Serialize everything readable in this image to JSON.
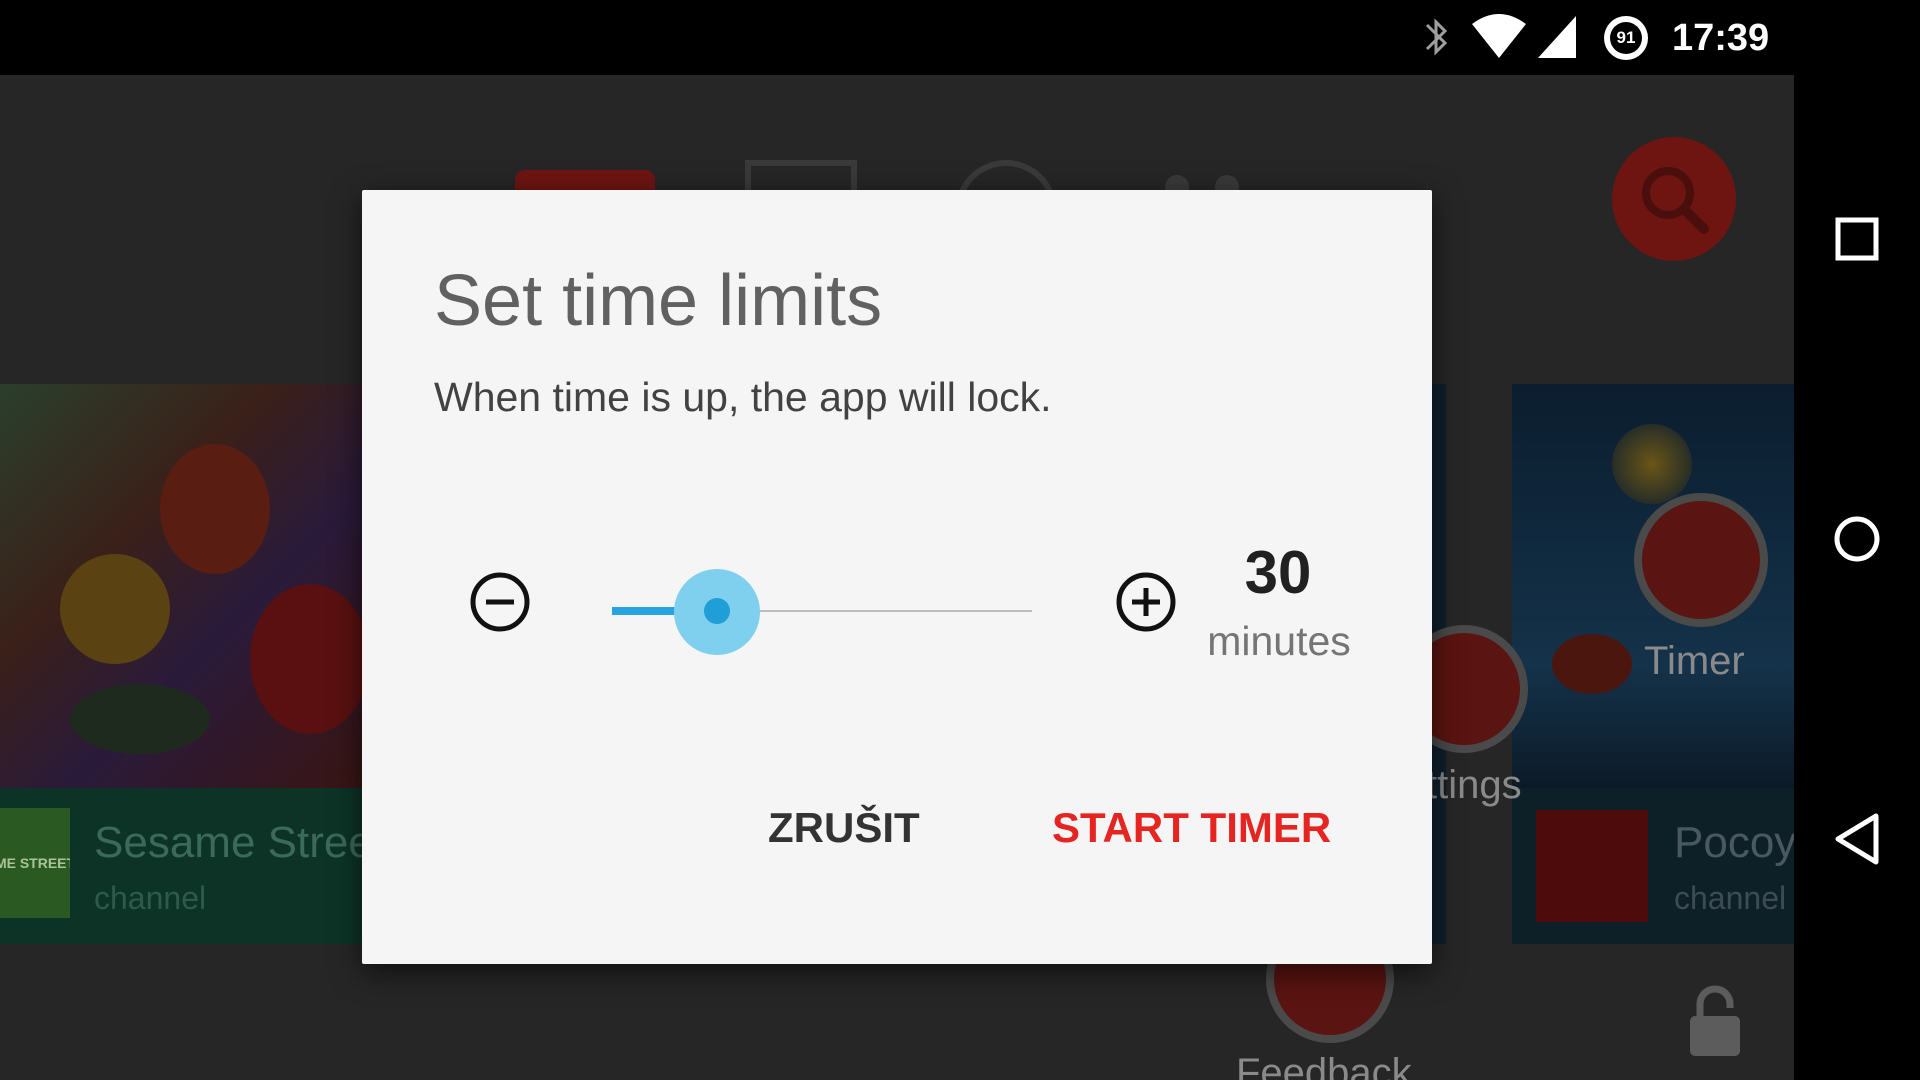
{
  "status_bar": {
    "time": "17:39",
    "battery_level": "91",
    "icons": [
      "bluetooth-icon",
      "wifi-icon",
      "cell-signal-icon",
      "battery-icon"
    ]
  },
  "background": {
    "tiles": [
      {
        "title": "Sesame Stree",
        "subtitle": "channel",
        "logo_text": "ME STREET"
      },
      {
        "title": "Pocoy",
        "subtitle": "channel"
      }
    ],
    "menu_items": [
      {
        "label": "Timer",
        "icon": "timer-icon"
      },
      {
        "label": "ttings",
        "icon": "settings-icon"
      },
      {
        "label": "Feedback",
        "icon": "feedback-icon"
      }
    ],
    "search_icon": "search-icon",
    "lock_icon": "lock-icon"
  },
  "dialog": {
    "title": "Set time limits",
    "message": "When time is up, the app will lock.",
    "slider": {
      "value_fraction": 0.25
    },
    "value_number": "30",
    "value_unit": "minutes",
    "cancel_label": "ZRUŠIT",
    "start_label": "START TIMER"
  },
  "nav": {
    "icons": [
      "recents-icon",
      "home-icon",
      "back-icon"
    ]
  },
  "colors": {
    "accent_red": "#e52521",
    "slider_blue": "#29a3e0",
    "dialog_bg": "#f5f5f5"
  }
}
